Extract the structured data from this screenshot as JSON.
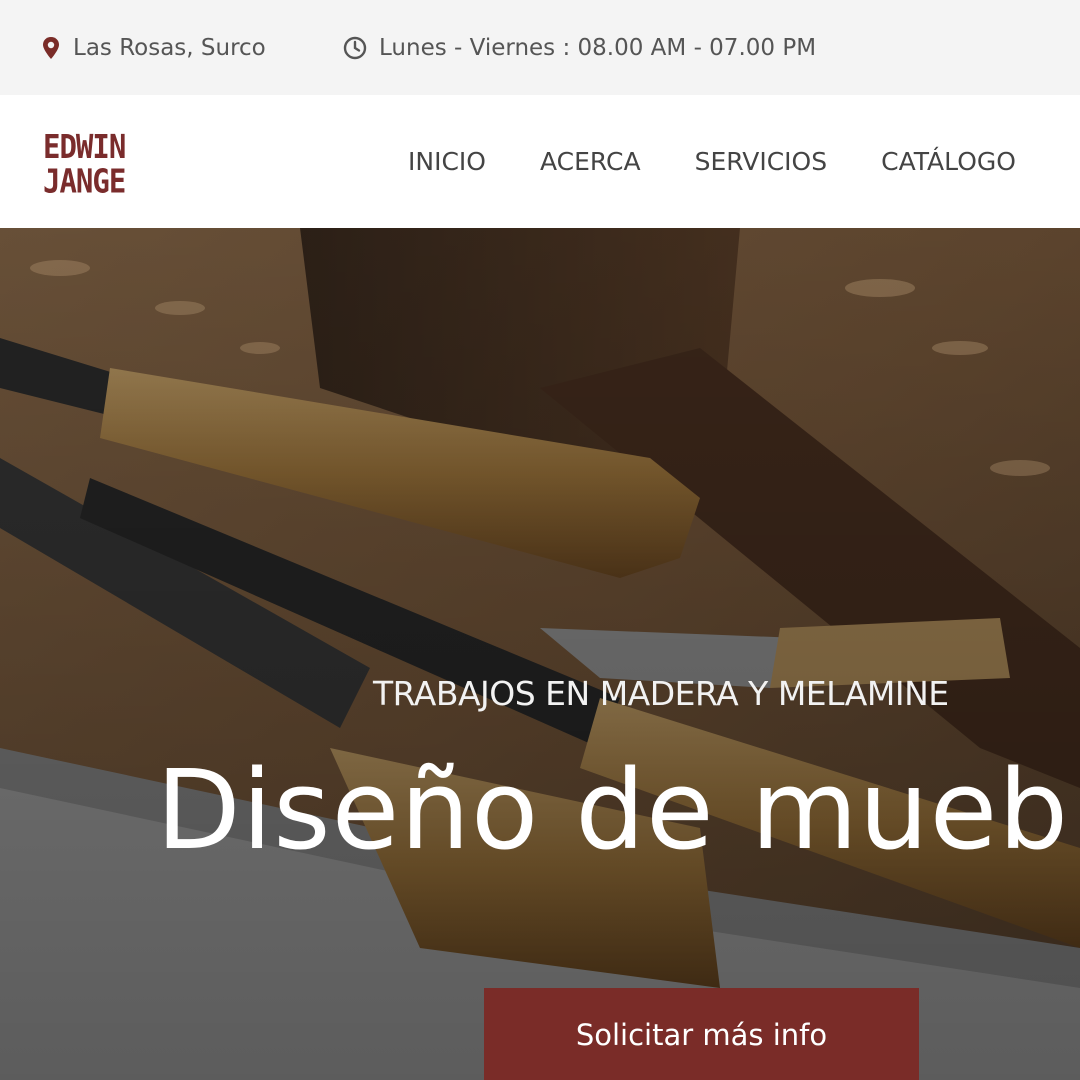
{
  "topbar": {
    "location_icon": "map-pin-icon",
    "location": "Las Rosas, Surco",
    "hours_icon": "clock-icon",
    "hours": "Lunes - Viernes : 08.00 AM - 07.00 PM"
  },
  "header": {
    "logo_line1": "EDWIN",
    "logo_line2": "JANGE",
    "nav": [
      {
        "label": "INICIO"
      },
      {
        "label": "ACERCA"
      },
      {
        "label": "SERVICIOS"
      },
      {
        "label": "CATÁLOGO"
      }
    ]
  },
  "hero": {
    "kicker": "TRABAJOS EN MADERA Y MELAMINE",
    "title": "Diseño de mueb",
    "cta_label": "Solicitar más info"
  },
  "colors": {
    "brand": "#7a2c28",
    "topbar_bg": "#f4f4f4",
    "text": "#444444"
  }
}
